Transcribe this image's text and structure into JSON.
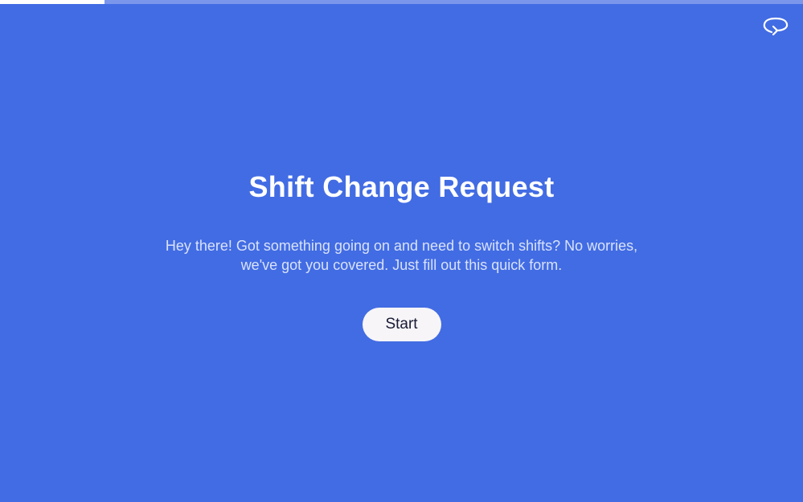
{
  "progress": {
    "percent": 13
  },
  "header": {
    "restart_icon": "restart-loop-arrow-icon"
  },
  "main": {
    "title": "Shift Change Request",
    "description": "Hey there! Got something going on and need to switch shifts? No worries, we've got you covered. Just fill out this quick form.",
    "start_label": "Start"
  },
  "colors": {
    "background": "#426ce3",
    "progress_track": "#7b97ec",
    "progress_fill": "#ffffff",
    "button_bg": "#f7f5f8",
    "button_text": "#161a33"
  }
}
